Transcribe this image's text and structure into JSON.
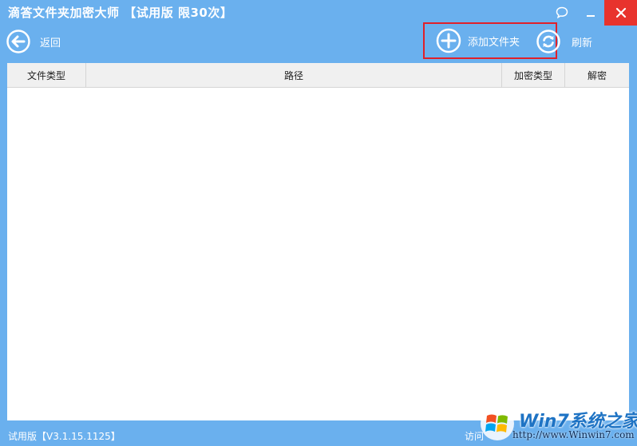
{
  "window": {
    "title": "滴答文件夹加密大师 【试用版 限30次】",
    "controls": {
      "feedback_icon": "chat-bubble-icon",
      "minimize_icon": "minimize-icon",
      "close_icon": "close-icon"
    }
  },
  "toolbar": {
    "back_label": "返回",
    "add_folder_label": "添加文件夹",
    "refresh_label": "刷新"
  },
  "table": {
    "columns": [
      "文件类型",
      "路径",
      "加密类型",
      "解密"
    ],
    "rows": []
  },
  "status": {
    "version": "试用版【V3.1.15.1125】",
    "visit": "访问"
  },
  "watermark": {
    "brand": "Win7系统之家",
    "url": "http://www.Winwin7.com"
  },
  "colors": {
    "window_bg": "#6ab0ee",
    "close_bg": "#e8332d",
    "highlight_border": "#e0202a",
    "header_bg": "#f0f0f0"
  }
}
